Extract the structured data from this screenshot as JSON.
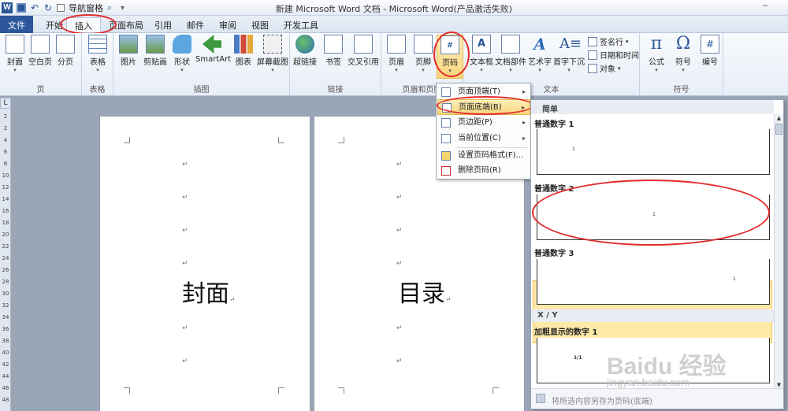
{
  "titlebar": {
    "title": "新建 Microsoft Word 文档 - Microsoft Word(产品激活失败)",
    "word_icon": "W",
    "nav_pane_label": "导航窗格",
    "minimize_glyph": "‒"
  },
  "tabs": [
    {
      "label": "文件"
    },
    {
      "label": "开始"
    },
    {
      "label": "插入"
    },
    {
      "label": "页面布局"
    },
    {
      "label": "引用"
    },
    {
      "label": "邮件"
    },
    {
      "label": "审阅"
    },
    {
      "label": "视图"
    },
    {
      "label": "开发工具"
    }
  ],
  "ribbon": {
    "groups": {
      "page": "页",
      "table": "表格",
      "illustration": "插图",
      "links": "链接",
      "header_footer": "页眉和页脚",
      "text": "文本",
      "symbols": "符号"
    },
    "buttons": {
      "cover": "封面",
      "blank": "空白页",
      "pagebreak": "分页",
      "table": "表格",
      "picture": "图片",
      "clipart": "剪贴画",
      "shapes": "形状",
      "smartart": "SmartArt",
      "chart": "图表",
      "screenshot": "屏幕截图",
      "hyperlink": "超链接",
      "bookmark": "书签",
      "crossref": "交叉引用",
      "header": "页眉",
      "footer": "页脚",
      "pagenum": "页码",
      "textbox": "文本框",
      "quickparts": "文档部件",
      "wordart": "艺术字",
      "dropcap": "首字下沉",
      "signature": "签名行",
      "datetime": "日期和时间",
      "object": "对象",
      "equation": "公式",
      "symbol": "符号",
      "number": "编号"
    },
    "icon_glyphs": {
      "pagenum": "#",
      "textbox": "A",
      "wordart": "A",
      "dropcap": "A≡",
      "equation": "π",
      "symbol": "Ω",
      "number": "#"
    }
  },
  "ruler": {
    "corner": "L",
    "ticks": [
      "2",
      "2",
      "4",
      "6",
      "8",
      "10",
      "12",
      "14",
      "16",
      "18",
      "20",
      "22",
      "24",
      "26",
      "28",
      "30",
      "32",
      "34",
      "36",
      "38",
      "40",
      "42",
      "44",
      "46",
      "48"
    ]
  },
  "pages": [
    {
      "big_text": "封面"
    },
    {
      "big_text": "目录"
    }
  ],
  "paragraph_mark": "↵",
  "menu": {
    "items": [
      {
        "label": "页面顶端(T)",
        "has_sub": true
      },
      {
        "label": "页面底端(B)",
        "has_sub": true
      },
      {
        "label": "页边距(P)",
        "has_sub": true
      },
      {
        "label": "当前位置(C)",
        "has_sub": true
      },
      {
        "label": "设置页码格式(F)...",
        "has_sub": false
      },
      {
        "label": "删除页码(R)",
        "has_sub": false
      }
    ],
    "submenu_arrow": "▸"
  },
  "gallery": {
    "header": "简单",
    "items": [
      {
        "title": "普通数字 1",
        "preview_num": "1"
      },
      {
        "title": "普通数字 2",
        "preview_num": "1"
      },
      {
        "title": "普通数字 3",
        "preview_num": "1"
      }
    ],
    "section": "X / Y",
    "bold_item": {
      "title": "加粗显示的数字 1",
      "preview_num": "1/1"
    },
    "footer": "将所选内容另存为页码(底端)"
  },
  "watermark": {
    "main": "Baidu 经验",
    "sub": "jingyan.baidu.com"
  },
  "colors": {
    "accent": "#2b579a",
    "highlight": "#f8d67e",
    "annotation": "#e32b2b"
  }
}
